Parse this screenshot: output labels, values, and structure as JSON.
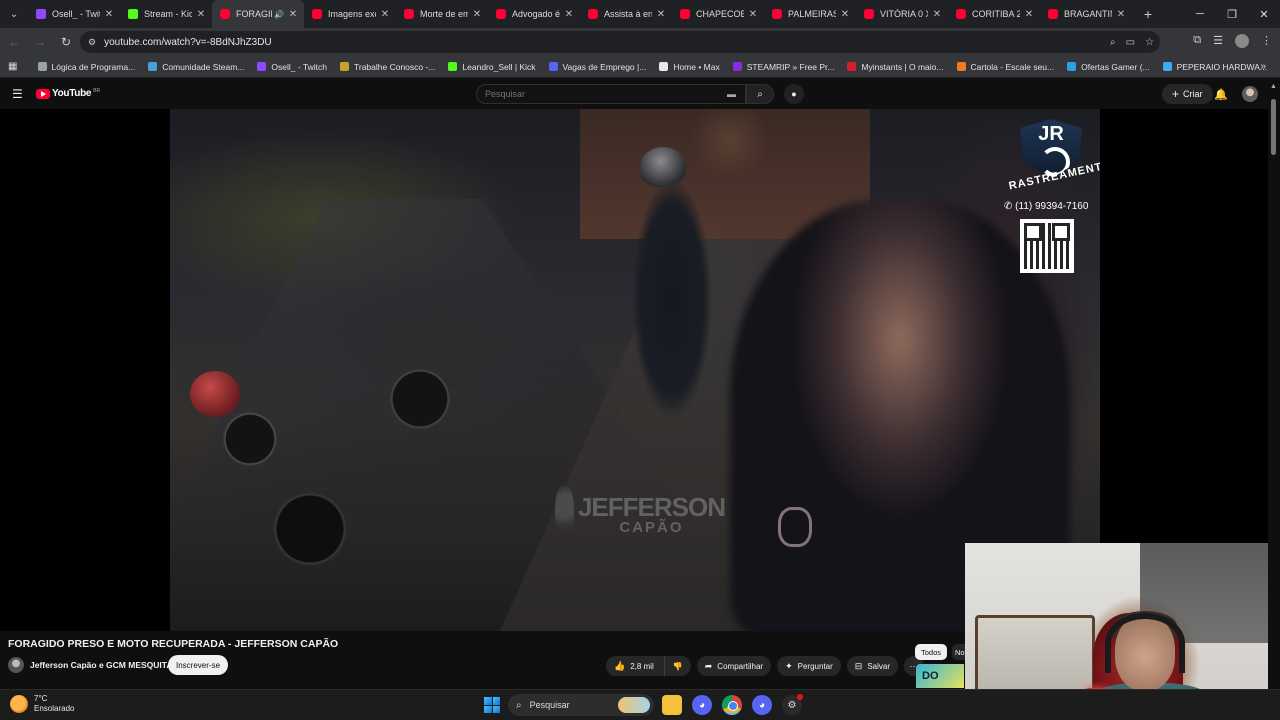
{
  "browser": {
    "tabs": [
      {
        "title": "Osell_ - Twitch",
        "favicon": "twitch-icon",
        "active": false
      },
      {
        "title": "Stream - Kick",
        "favicon": "kick-icon",
        "active": false
      },
      {
        "title": "FORAGIDO",
        "favicon": "youtube-icon",
        "active": true,
        "audio": true
      },
      {
        "title": "Imagens exc",
        "favicon": "youtube-icon",
        "active": false
      },
      {
        "title": "Morte de em",
        "favicon": "youtube-icon",
        "active": false
      },
      {
        "title": "Advogado é",
        "favicon": "youtube-icon",
        "active": false
      },
      {
        "title": "Assista à en",
        "favicon": "youtube-icon",
        "active": false
      },
      {
        "title": "CHAPECOEN",
        "favicon": "youtube-icon",
        "active": false
      },
      {
        "title": "PALMEIRAS",
        "favicon": "youtube-icon",
        "active": false
      },
      {
        "title": "VITÓRIA 0 X",
        "favicon": "youtube-icon",
        "active": false
      },
      {
        "title": "CORITIBA 2",
        "favicon": "youtube-icon",
        "active": false
      },
      {
        "title": "BRAGANTIN",
        "favicon": "youtube-icon",
        "active": false
      }
    ],
    "url": "youtube.com/watch?v=-8BdNJhZ3DU",
    "bookmarks": [
      {
        "label": "Lógica de Programa...",
        "color": "#9aa0a6"
      },
      {
        "label": "Comunidade Steam...",
        "color": "#4a9fd8"
      },
      {
        "label": "Osell_ - Twitch",
        "color": "#9146ff"
      },
      {
        "label": "Trabalhe Conosco -...",
        "color": "#c9a227"
      },
      {
        "label": "Leandro_Sell | Kick",
        "color": "#53fc18"
      },
      {
        "label": "Vagas de Emprego |...",
        "color": "#5865f2"
      },
      {
        "label": "Home • Max",
        "color": "#e8e8e8"
      },
      {
        "label": "STEAMRIP » Free Pr...",
        "color": "#8a2be2"
      },
      {
        "label": "Myinstants | O maio...",
        "color": "#d61f2c"
      },
      {
        "label": "Cartola - Escale seu...",
        "color": "#f07b22"
      },
      {
        "label": "Ofertas Gamer (...",
        "color": "#2aa2e4"
      },
      {
        "label": "PEPERAIO HARDWA...",
        "color": "#3fa9f5"
      }
    ]
  },
  "youtube": {
    "logo_text": "YouTube",
    "region": "BR",
    "search_placeholder": "Pesquisar",
    "create_label": "Criar",
    "video": {
      "title": "FORAGIDO PRESO E MOTO RECUPERADA - JEFFERSON CAPÃO",
      "watermark_line1": "JEFFERSON",
      "watermark_line2": "CAPÃO",
      "overlay_logo": "JR",
      "overlay_logo_sub": "RASTREAMENTO",
      "overlay_phone": "(11) 99394-7160"
    },
    "channel": {
      "name": "Jefferson Capão e GCM MESQUITA",
      "subscribe_label": "Inscrever-se"
    },
    "actions": {
      "likes": "2,8 mil",
      "share": "Compartilhar",
      "ask": "Perguntar",
      "save": "Salvar"
    },
    "chips": {
      "all": "Todos",
      "next_partial": "No"
    },
    "thumb_partial_text": "DO"
  },
  "taskbar": {
    "temperature": "7°C",
    "weather_desc": "Ensolarado",
    "search_label": "Pesquisar"
  }
}
